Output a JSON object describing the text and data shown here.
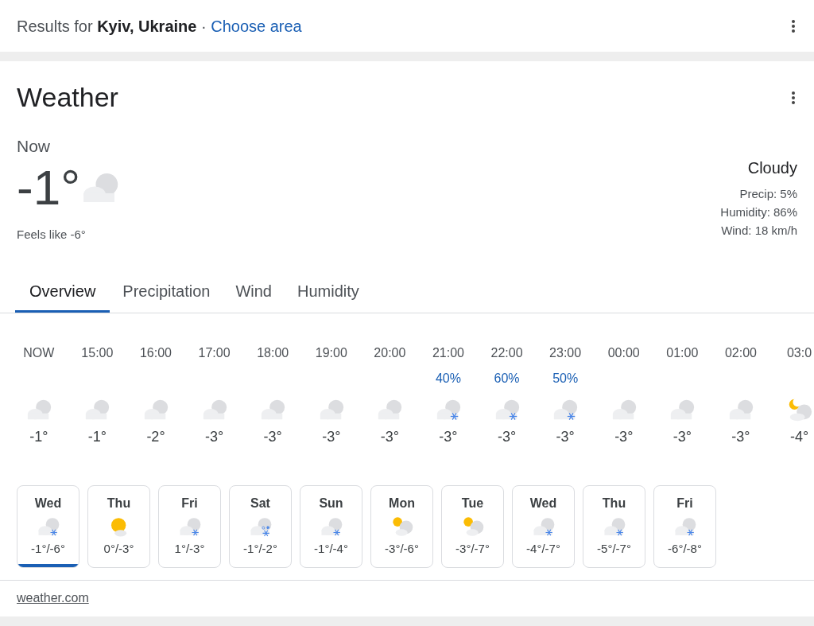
{
  "header": {
    "prefix": "Results for ",
    "location": "Kyiv, Ukraine",
    "separator": " · ",
    "link": "Choose area"
  },
  "card": {
    "title": "Weather",
    "now": {
      "label": "Now",
      "temp": "-1°",
      "kind": "cloudy",
      "feels_like": "Feels like -6°"
    },
    "summary": {
      "condition": "Cloudy",
      "details": [
        "Precip: 5%",
        "Humidity: 86%",
        "Wind: 18 km/h"
      ]
    },
    "tabs": [
      {
        "label": "Overview",
        "selected": true
      },
      {
        "label": "Precipitation",
        "selected": false
      },
      {
        "label": "Wind",
        "selected": false
      },
      {
        "label": "Humidity",
        "selected": false
      }
    ],
    "hours": [
      {
        "time": "NOW",
        "kind": "cloudy",
        "temp": "-1°"
      },
      {
        "time": "15:00",
        "kind": "cloudy",
        "temp": "-1°"
      },
      {
        "time": "16:00",
        "kind": "cloudy",
        "temp": "-2°"
      },
      {
        "time": "17:00",
        "kind": "cloudy",
        "temp": "-3°"
      },
      {
        "time": "18:00",
        "kind": "cloudy",
        "temp": "-3°"
      },
      {
        "time": "19:00",
        "kind": "cloudy",
        "temp": "-3°"
      },
      {
        "time": "20:00",
        "kind": "cloudy",
        "temp": "-3°"
      },
      {
        "time": "21:00",
        "precip": "40%",
        "kind": "snow",
        "temp": "-3°"
      },
      {
        "time": "22:00",
        "precip": "60%",
        "kind": "snow",
        "temp": "-3°"
      },
      {
        "time": "23:00",
        "precip": "50%",
        "kind": "snow",
        "temp": "-3°"
      },
      {
        "time": "00:00",
        "kind": "cloudy",
        "temp": "-3°"
      },
      {
        "time": "01:00",
        "kind": "cloudy",
        "temp": "-3°"
      },
      {
        "time": "02:00",
        "kind": "cloudy",
        "temp": "-3°"
      },
      {
        "time": "03:0",
        "kind": "night",
        "temp": "-4°"
      }
    ],
    "days": [
      {
        "day": "Wed",
        "kind": "snow",
        "range": "-1°/-6°",
        "selected": true
      },
      {
        "day": "Thu",
        "kind": "sunny",
        "range": "0°/-3°",
        "selected": false
      },
      {
        "day": "Fri",
        "kind": "snow",
        "range": "1°/-3°",
        "selected": false
      },
      {
        "day": "Sat",
        "kind": "sleet",
        "range": "-1°/-2°",
        "selected": false
      },
      {
        "day": "Sun",
        "kind": "snow",
        "range": "-1°/-4°",
        "selected": false
      },
      {
        "day": "Mon",
        "kind": "partly",
        "range": "-3°/-6°",
        "selected": false
      },
      {
        "day": "Tue",
        "kind": "partly",
        "range": "-3°/-7°",
        "selected": false
      },
      {
        "day": "Wed",
        "kind": "snow",
        "range": "-4°/-7°",
        "selected": false
      },
      {
        "day": "Thu",
        "kind": "snow",
        "range": "-5°/-7°",
        "selected": false
      },
      {
        "day": "Fri",
        "kind": "snow",
        "range": "-6°/-8°",
        "selected": false
      }
    ],
    "source": "weather.com"
  }
}
